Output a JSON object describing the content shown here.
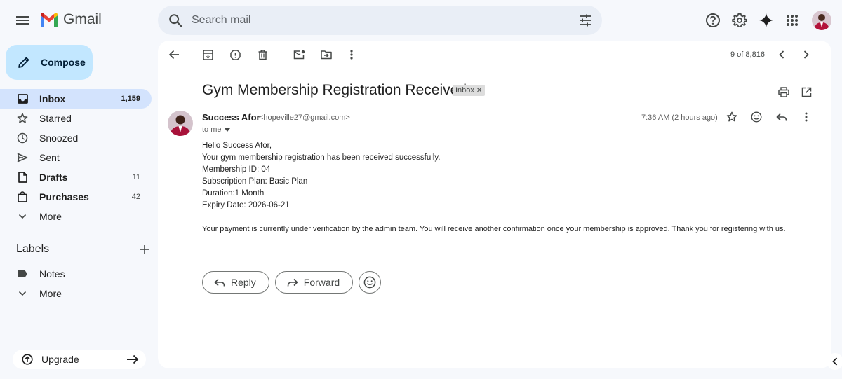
{
  "app": {
    "name": "Gmail"
  },
  "search": {
    "placeholder": "Search mail"
  },
  "compose": {
    "label": "Compose"
  },
  "nav": [
    {
      "label": "Inbox",
      "count": "1,159"
    },
    {
      "label": "Starred",
      "count": ""
    },
    {
      "label": "Snoozed",
      "count": ""
    },
    {
      "label": "Sent",
      "count": ""
    },
    {
      "label": "Drafts",
      "count": "11"
    },
    {
      "label": "Purchases",
      "count": "42"
    },
    {
      "label": "More",
      "count": ""
    }
  ],
  "labels": {
    "title": "Labels",
    "items": [
      {
        "label": "Notes"
      },
      {
        "label": "More"
      }
    ]
  },
  "upgrade": {
    "label": "Upgrade"
  },
  "pager": {
    "text": "9 of 8,816"
  },
  "email": {
    "subject": "Gym Membership Registration Received",
    "badge": "Inbox",
    "sender_name": "Success Afor",
    "sender_email": "<hopeville27@gmail.com>",
    "to": "to me",
    "time": "7:36 AM (2 hours ago)",
    "lines": [
      "Hello Success Afor,",
      "Your gym membership registration has been received successfully.",
      "Membership ID: 04",
      "Subscription Plan: Basic Plan",
      "Duration:1 Month",
      "Expiry Date: 2026-06-21"
    ],
    "closing": "Your payment is currently under verification by the admin team.  You will receive another confirmation once your membership is approved.  Thank you for registering with us."
  },
  "actions": {
    "reply": "Reply",
    "forward": "Forward"
  },
  "colors": {
    "accent": "#0b57d0",
    "compose_bg": "#c2e7ff",
    "active_nav": "#d3e3fd"
  }
}
